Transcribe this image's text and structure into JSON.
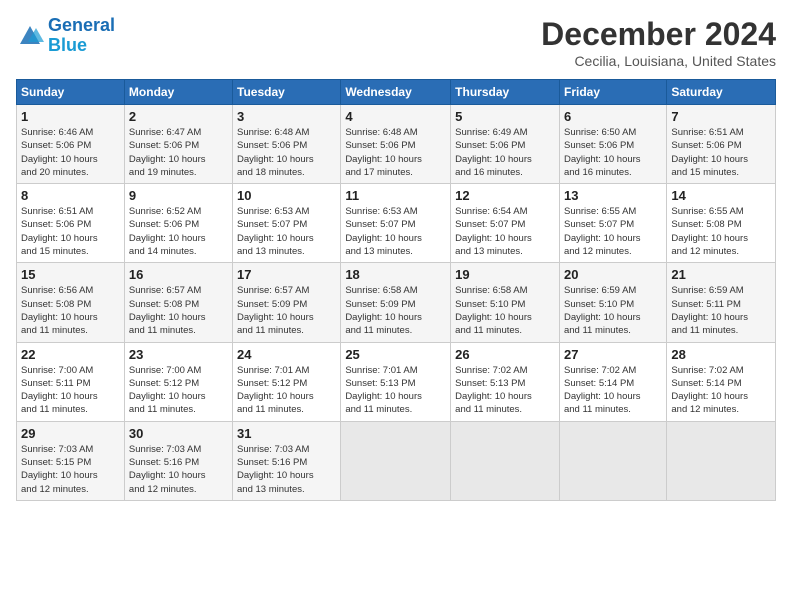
{
  "header": {
    "logo_line1": "General",
    "logo_line2": "Blue",
    "title": "December 2024",
    "subtitle": "Cecilia, Louisiana, United States"
  },
  "days_of_week": [
    "Sunday",
    "Monday",
    "Tuesday",
    "Wednesday",
    "Thursday",
    "Friday",
    "Saturday"
  ],
  "weeks": [
    [
      {
        "day": "1",
        "info": "Sunrise: 6:46 AM\nSunset: 5:06 PM\nDaylight: 10 hours\nand 20 minutes."
      },
      {
        "day": "2",
        "info": "Sunrise: 6:47 AM\nSunset: 5:06 PM\nDaylight: 10 hours\nand 19 minutes."
      },
      {
        "day": "3",
        "info": "Sunrise: 6:48 AM\nSunset: 5:06 PM\nDaylight: 10 hours\nand 18 minutes."
      },
      {
        "day": "4",
        "info": "Sunrise: 6:48 AM\nSunset: 5:06 PM\nDaylight: 10 hours\nand 17 minutes."
      },
      {
        "day": "5",
        "info": "Sunrise: 6:49 AM\nSunset: 5:06 PM\nDaylight: 10 hours\nand 16 minutes."
      },
      {
        "day": "6",
        "info": "Sunrise: 6:50 AM\nSunset: 5:06 PM\nDaylight: 10 hours\nand 16 minutes."
      },
      {
        "day": "7",
        "info": "Sunrise: 6:51 AM\nSunset: 5:06 PM\nDaylight: 10 hours\nand 15 minutes."
      }
    ],
    [
      {
        "day": "8",
        "info": "Sunrise: 6:51 AM\nSunset: 5:06 PM\nDaylight: 10 hours\nand 15 minutes."
      },
      {
        "day": "9",
        "info": "Sunrise: 6:52 AM\nSunset: 5:06 PM\nDaylight: 10 hours\nand 14 minutes."
      },
      {
        "day": "10",
        "info": "Sunrise: 6:53 AM\nSunset: 5:07 PM\nDaylight: 10 hours\nand 13 minutes."
      },
      {
        "day": "11",
        "info": "Sunrise: 6:53 AM\nSunset: 5:07 PM\nDaylight: 10 hours\nand 13 minutes."
      },
      {
        "day": "12",
        "info": "Sunrise: 6:54 AM\nSunset: 5:07 PM\nDaylight: 10 hours\nand 13 minutes."
      },
      {
        "day": "13",
        "info": "Sunrise: 6:55 AM\nSunset: 5:07 PM\nDaylight: 10 hours\nand 12 minutes."
      },
      {
        "day": "14",
        "info": "Sunrise: 6:55 AM\nSunset: 5:08 PM\nDaylight: 10 hours\nand 12 minutes."
      }
    ],
    [
      {
        "day": "15",
        "info": "Sunrise: 6:56 AM\nSunset: 5:08 PM\nDaylight: 10 hours\nand 11 minutes."
      },
      {
        "day": "16",
        "info": "Sunrise: 6:57 AM\nSunset: 5:08 PM\nDaylight: 10 hours\nand 11 minutes."
      },
      {
        "day": "17",
        "info": "Sunrise: 6:57 AM\nSunset: 5:09 PM\nDaylight: 10 hours\nand 11 minutes."
      },
      {
        "day": "18",
        "info": "Sunrise: 6:58 AM\nSunset: 5:09 PM\nDaylight: 10 hours\nand 11 minutes."
      },
      {
        "day": "19",
        "info": "Sunrise: 6:58 AM\nSunset: 5:10 PM\nDaylight: 10 hours\nand 11 minutes."
      },
      {
        "day": "20",
        "info": "Sunrise: 6:59 AM\nSunset: 5:10 PM\nDaylight: 10 hours\nand 11 minutes."
      },
      {
        "day": "21",
        "info": "Sunrise: 6:59 AM\nSunset: 5:11 PM\nDaylight: 10 hours\nand 11 minutes."
      }
    ],
    [
      {
        "day": "22",
        "info": "Sunrise: 7:00 AM\nSunset: 5:11 PM\nDaylight: 10 hours\nand 11 minutes."
      },
      {
        "day": "23",
        "info": "Sunrise: 7:00 AM\nSunset: 5:12 PM\nDaylight: 10 hours\nand 11 minutes."
      },
      {
        "day": "24",
        "info": "Sunrise: 7:01 AM\nSunset: 5:12 PM\nDaylight: 10 hours\nand 11 minutes."
      },
      {
        "day": "25",
        "info": "Sunrise: 7:01 AM\nSunset: 5:13 PM\nDaylight: 10 hours\nand 11 minutes."
      },
      {
        "day": "26",
        "info": "Sunrise: 7:02 AM\nSunset: 5:13 PM\nDaylight: 10 hours\nand 11 minutes."
      },
      {
        "day": "27",
        "info": "Sunrise: 7:02 AM\nSunset: 5:14 PM\nDaylight: 10 hours\nand 11 minutes."
      },
      {
        "day": "28",
        "info": "Sunrise: 7:02 AM\nSunset: 5:14 PM\nDaylight: 10 hours\nand 12 minutes."
      }
    ],
    [
      {
        "day": "29",
        "info": "Sunrise: 7:03 AM\nSunset: 5:15 PM\nDaylight: 10 hours\nand 12 minutes."
      },
      {
        "day": "30",
        "info": "Sunrise: 7:03 AM\nSunset: 5:16 PM\nDaylight: 10 hours\nand 12 minutes."
      },
      {
        "day": "31",
        "info": "Sunrise: 7:03 AM\nSunset: 5:16 PM\nDaylight: 10 hours\nand 13 minutes."
      },
      {
        "day": "",
        "info": ""
      },
      {
        "day": "",
        "info": ""
      },
      {
        "day": "",
        "info": ""
      },
      {
        "day": "",
        "info": ""
      }
    ]
  ]
}
